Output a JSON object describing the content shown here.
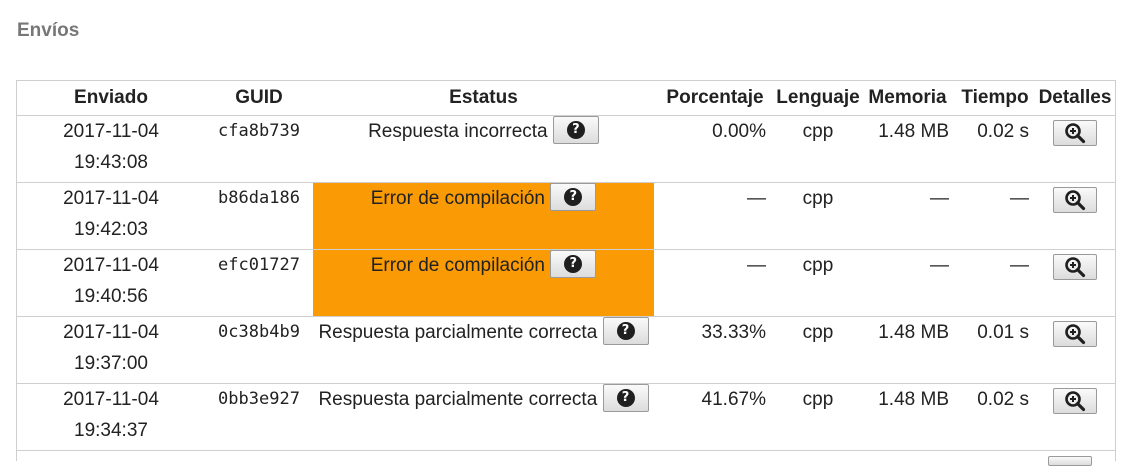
{
  "section": {
    "title": "Envíos"
  },
  "table": {
    "headers": {
      "sent": "Enviado",
      "guid": "GUID",
      "status": "Estatus",
      "percent": "Porcentaje",
      "language": "Lenguaje",
      "memory": "Memoria",
      "time": "Tiempo",
      "details": "Detalles"
    },
    "rows": [
      {
        "date": "2017-11-04",
        "time_of_day": "19:43:08",
        "guid": "cfa8b739",
        "status": "Respuesta incorrecta",
        "status_error": false,
        "percent": "0.00%",
        "language": "cpp",
        "memory": "1.48 MB",
        "runtime": "0.02 s"
      },
      {
        "date": "2017-11-04",
        "time_of_day": "19:42:03",
        "guid": "b86da186",
        "status": "Error de compilación",
        "status_error": true,
        "percent": "—",
        "language": "cpp",
        "memory": "—",
        "runtime": "—"
      },
      {
        "date": "2017-11-04",
        "time_of_day": "19:40:56",
        "guid": "efc01727",
        "status": "Error de compilación",
        "status_error": true,
        "percent": "—",
        "language": "cpp",
        "memory": "—",
        "runtime": "—"
      },
      {
        "date": "2017-11-04",
        "time_of_day": "19:37:00",
        "guid": "0c38b4b9",
        "status": "Respuesta parcialmente correcta",
        "status_error": false,
        "percent": "33.33%",
        "language": "cpp",
        "memory": "1.48 MB",
        "runtime": "0.01 s"
      },
      {
        "date": "2017-11-04",
        "time_of_day": "19:34:37",
        "guid": "0bb3e927",
        "status": "Respuesta parcialmente correcta",
        "status_error": false,
        "percent": "41.67%",
        "language": "cpp",
        "memory": "1.48 MB",
        "runtime": "0.02 s"
      }
    ]
  },
  "icons": {
    "help": "question-circle-icon",
    "details": "magnifier-zoom-icon"
  },
  "colors": {
    "error_status": "#fa9a05",
    "title": "#777777",
    "border": "#cfcfcf"
  }
}
